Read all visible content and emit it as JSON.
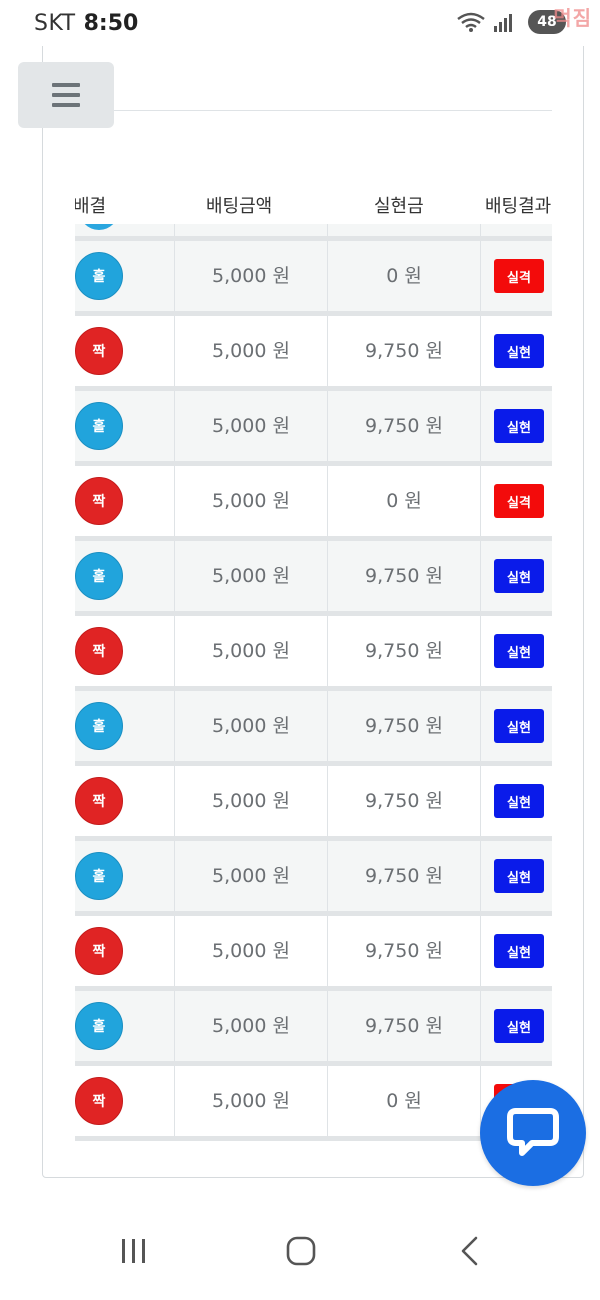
{
  "status_bar": {
    "carrier": "SKT",
    "time": "8:50",
    "battery": "48",
    "watermark": "먹짐"
  },
  "table": {
    "headers": [
      "배결",
      "배팅금액",
      "실현금",
      "배팅결과"
    ],
    "rows": [
      {
        "pick": "홀",
        "color": "blue",
        "bet": "5,000 원",
        "payout": "0 원",
        "result": "실격",
        "status": "lose"
      },
      {
        "pick": "짝",
        "color": "red",
        "bet": "5,000 원",
        "payout": "9,750 원",
        "result": "실현",
        "status": "win"
      },
      {
        "pick": "홀",
        "color": "blue",
        "bet": "5,000 원",
        "payout": "9,750 원",
        "result": "실현",
        "status": "win"
      },
      {
        "pick": "짝",
        "color": "red",
        "bet": "5,000 원",
        "payout": "0 원",
        "result": "실격",
        "status": "lose"
      },
      {
        "pick": "홀",
        "color": "blue",
        "bet": "5,000 원",
        "payout": "9,750 원",
        "result": "실현",
        "status": "win"
      },
      {
        "pick": "짝",
        "color": "red",
        "bet": "5,000 원",
        "payout": "9,750 원",
        "result": "실현",
        "status": "win"
      },
      {
        "pick": "홀",
        "color": "blue",
        "bet": "5,000 원",
        "payout": "9,750 원",
        "result": "실현",
        "status": "win"
      },
      {
        "pick": "짝",
        "color": "red",
        "bet": "5,000 원",
        "payout": "9,750 원",
        "result": "실현",
        "status": "win"
      },
      {
        "pick": "홀",
        "color": "blue",
        "bet": "5,000 원",
        "payout": "9,750 원",
        "result": "실현",
        "status": "win"
      },
      {
        "pick": "짝",
        "color": "red",
        "bet": "5,000 원",
        "payout": "9,750 원",
        "result": "실현",
        "status": "win"
      },
      {
        "pick": "홀",
        "color": "blue",
        "bet": "5,000 원",
        "payout": "9,750 원",
        "result": "실현",
        "status": "win"
      },
      {
        "pick": "짝",
        "color": "red",
        "bet": "5,000 원",
        "payout": "0 원",
        "result": "실격",
        "status": "lose"
      }
    ]
  },
  "colors": {
    "blue_ball": "#21a4dc",
    "red_ball": "#e02424",
    "win_badge": "#0a1bea",
    "lose_badge": "#f30b0b",
    "chat_fab": "#1b6ee3"
  },
  "icons": {
    "menu": "hamburger-icon",
    "chat": "chat-bubble-icon",
    "nav_recent": "recent-apps-icon",
    "nav_home": "home-icon",
    "nav_back": "back-icon"
  }
}
